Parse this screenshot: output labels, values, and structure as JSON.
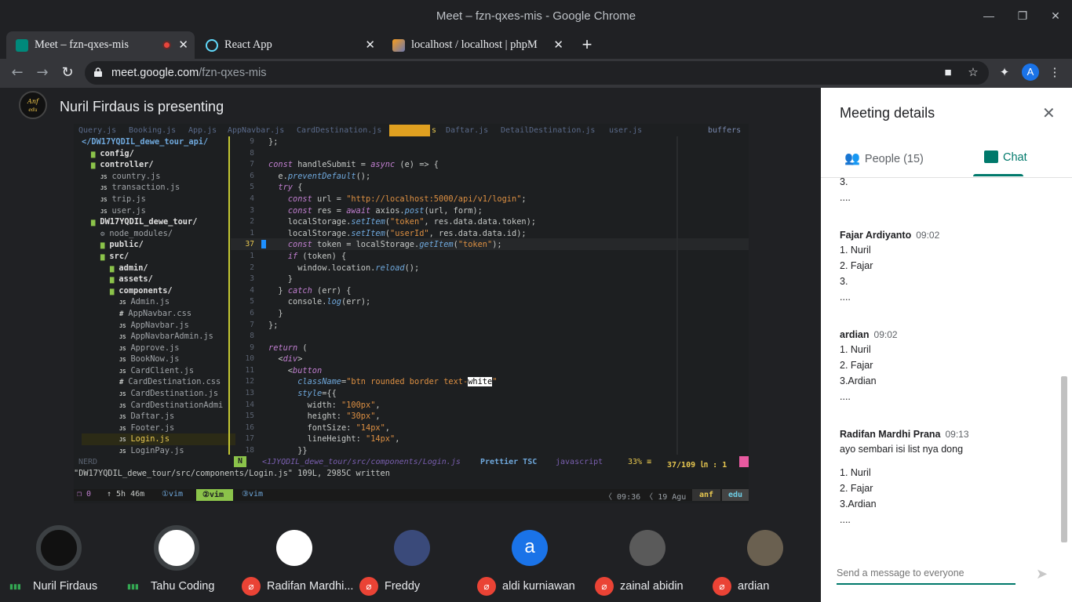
{
  "window": {
    "title": "Meet – fzn-qxes-mis - Google Chrome"
  },
  "tabs": [
    {
      "label": "Meet – fzn-qxes-mis",
      "icon": "meet-icon"
    },
    {
      "label": "React App",
      "icon": "react-icon"
    },
    {
      "label": "localhost / localhost | phpM",
      "icon": "phpmyadmin-icon"
    }
  ],
  "omnibox": {
    "domain": "meet.google.com",
    "path": "/fzn-qxes-mis"
  },
  "profile": {
    "initial": "A"
  },
  "stage": {
    "presenting": "Nuril Firdaus is presenting"
  },
  "vim": {
    "buffers": [
      "Query.js",
      "Booking.js",
      "App.js",
      "AppNavbar.js",
      "CardDestination.js",
      "s",
      "Daftar.js",
      "DetailDestination.js",
      "user.js"
    ],
    "buffers_label": "buffers",
    "tree": [
      {
        "t": "</DW17YQDIL_dewe_tour_api/",
        "c": "#6fa8dc",
        "i": 0,
        "b": true
      },
      {
        "t": "config/",
        "c": "#e0e0e0",
        "i": 1,
        "b": true,
        "icon": "folder"
      },
      {
        "t": "controller/",
        "c": "#e0e0e0",
        "i": 1,
        "b": true,
        "icon": "folder-open"
      },
      {
        "t": "country.js",
        "c": "#a0a4a8",
        "i": 2,
        "icon": "js"
      },
      {
        "t": "transaction.js",
        "c": "#a0a4a8",
        "i": 2,
        "icon": "js"
      },
      {
        "t": "trip.js",
        "c": "#a0a4a8",
        "i": 2,
        "icon": "js"
      },
      {
        "t": "user.js",
        "c": "#a0a4a8",
        "i": 2,
        "icon": "js"
      },
      {
        "t": "DW17YQDIL_dewe_tour/",
        "c": "#e0e0e0",
        "i": 1,
        "b": true,
        "icon": "folder-open"
      },
      {
        "t": "node_modules/",
        "c": "#a0a4a8",
        "i": 2,
        "icon": "gear"
      },
      {
        "t": "public/",
        "c": "#e0e0e0",
        "i": 2,
        "b": true,
        "icon": "folder"
      },
      {
        "t": "src/",
        "c": "#e0e0e0",
        "i": 2,
        "b": true,
        "icon": "folder-open"
      },
      {
        "t": "admin/",
        "c": "#e0e0e0",
        "i": 3,
        "b": true,
        "icon": "folder"
      },
      {
        "t": "assets/",
        "c": "#e0e0e0",
        "i": 3,
        "b": true,
        "icon": "folder"
      },
      {
        "t": "components/",
        "c": "#e0e0e0",
        "i": 3,
        "b": true,
        "icon": "folder-open"
      },
      {
        "t": "Admin.js",
        "c": "#a0a4a8",
        "i": 4,
        "icon": "js"
      },
      {
        "t": "AppNavbar.css",
        "c": "#a0a4a8",
        "i": 4,
        "icon": "css"
      },
      {
        "t": "AppNavbar.js",
        "c": "#a0a4a8",
        "i": 4,
        "icon": "js"
      },
      {
        "t": "AppNavbarAdmin.js",
        "c": "#a0a4a8",
        "i": 4,
        "icon": "js"
      },
      {
        "t": "Approve.js",
        "c": "#a0a4a8",
        "i": 4,
        "icon": "js"
      },
      {
        "t": "BookNow.js",
        "c": "#a0a4a8",
        "i": 4,
        "icon": "js"
      },
      {
        "t": "CardClient.js",
        "c": "#a0a4a8",
        "i": 4,
        "icon": "js"
      },
      {
        "t": "CardDestination.css",
        "c": "#a0a4a8",
        "i": 4,
        "icon": "css"
      },
      {
        "t": "CardDestination.js",
        "c": "#a0a4a8",
        "i": 4,
        "icon": "js"
      },
      {
        "t": "CardDestinationAdmi",
        "c": "#a0a4a8",
        "i": 4,
        "icon": "js"
      },
      {
        "t": "Daftar.js",
        "c": "#a0a4a8",
        "i": 4,
        "icon": "js"
      },
      {
        "t": "Footer.js",
        "c": "#a0a4a8",
        "i": 4,
        "icon": "js"
      },
      {
        "t": "Login.js",
        "c": "#e8c850",
        "i": 4,
        "icon": "js",
        "hl": true
      },
      {
        "t": "LoginPay.js",
        "c": "#a0a4a8",
        "i": 4,
        "icon": "js"
      }
    ],
    "gutter": [
      "9",
      "8",
      "7",
      "6",
      "5",
      "4",
      "3",
      "2",
      "1",
      "37",
      "1",
      "2",
      "3",
      "4",
      "5",
      "6",
      "7",
      "8",
      "9",
      "10",
      "11",
      "12",
      "13",
      "14",
      "15",
      "16",
      "17",
      "18"
    ],
    "code": [
      "};",
      "",
      "<k>const</k> handleSubmit = <k>async</k> (e) => {",
      "  e.<f>preventDefault</f>();",
      "  <k>try</k> {",
      "    <k>const</k> url = <s>\"http://localhost:5000/api/v1/login\"</s>;",
      "    <k>const</k> res = <k>await</k> axios.<f>post</f>(url, form);",
      "    localStorage.<f>setItem</f>(<s>\"token\"</s>, res.data.data.token);",
      "    localStorage.<f>setItem</f>(<s>\"userId\"</s>, res.data.data.id);",
      "    <k>const</k> token = localStorage.<f>getItem</f>(<s>\"token\"</s>);",
      "    <k>if</k> (token) {",
      "      window.location.<f>reload</f>();",
      "    }",
      "  } <k>catch</k> (err) {",
      "    console.<f>log</f>(err);",
      "  }",
      "};",
      "",
      "<k>return</k> (",
      "  <<k>div</k>>",
      "    <<k>button</k>",
      "      <f>className</f>=<s>\"btn rounded border text-</s><w>white</w><s>\"</s>",
      "      <f>style</f>={{",
      "        width: <s>\"100px\"</s>,",
      "        height: <s>\"30px\"</s>,",
      "        fontSize: <s>\"14px\"</s>,",
      "        lineHeight: <s>\"14px\"</s>,",
      "      }}"
    ],
    "status": {
      "left": "NERD",
      "mode": "N",
      "file": "<1JYQDIL_dewe_tour/src/components/Login.js",
      "prettier": "Prettier TSC",
      "ft": "javascript",
      "pct": "33% ≡",
      "pos": "37/109 ㏑ :  1"
    },
    "message": "\"DW17YQDIL_dewe_tour/src/components/Login.js\" 109L, 2985C written",
    "tmux": {
      "session": "0",
      "uptime": "↑ 5h 46m",
      "w1": "①vim",
      "w2": "②vim",
      "w3": "③vim",
      "time": "09:36",
      "date": "19 Agu",
      "host": "anf",
      "user": "edu"
    }
  },
  "participants": [
    {
      "name": "Nuril Firdaus",
      "mic": "on",
      "avatar": "anf-logo"
    },
    {
      "name": "Tahu Coding",
      "mic": "on",
      "avatar": "tahu-logo"
    },
    {
      "name": "Radifan Mardhi...",
      "mic": "off",
      "avatar": "sketch-photo"
    },
    {
      "name": "Freddy",
      "mic": "off",
      "avatar": "person-photo"
    },
    {
      "name": "aldi kurniawan",
      "mic": "off",
      "avatar": "letter-a",
      "letter": "a"
    },
    {
      "name": "zainal abidin",
      "mic": "off",
      "avatar": "person-photo"
    },
    {
      "name": "ardian",
      "mic": "off",
      "avatar": "person-photo"
    }
  ],
  "panel": {
    "title": "Meeting details",
    "people_tab": "People (15)",
    "chat_tab": "Chat",
    "input_placeholder": "Send a message to everyone",
    "messages": [
      {
        "lines": [
          "3.",
          "...."
        ]
      },
      {
        "sender": "Fajar Ardiyanto",
        "time": "09:02",
        "lines": [
          "1. Nuril",
          "2. Fajar",
          "3.",
          "...."
        ]
      },
      {
        "sender": "ardian",
        "time": "09:02",
        "lines": [
          "1. Nuril",
          "2. Fajar",
          "3.Ardian",
          "...."
        ]
      },
      {
        "sender": "Radifan Mardhi Prana",
        "time": "09:13",
        "lines": [
          "ayo sembari isi list nya dong"
        ],
        "lines2": [
          "1. Nuril",
          "2. Fajar",
          "3.Ardian",
          "...."
        ]
      }
    ]
  },
  "colors": {
    "accent": "#00796b",
    "danger": "#ea4335",
    "brand_blue": "#1a73e8"
  }
}
